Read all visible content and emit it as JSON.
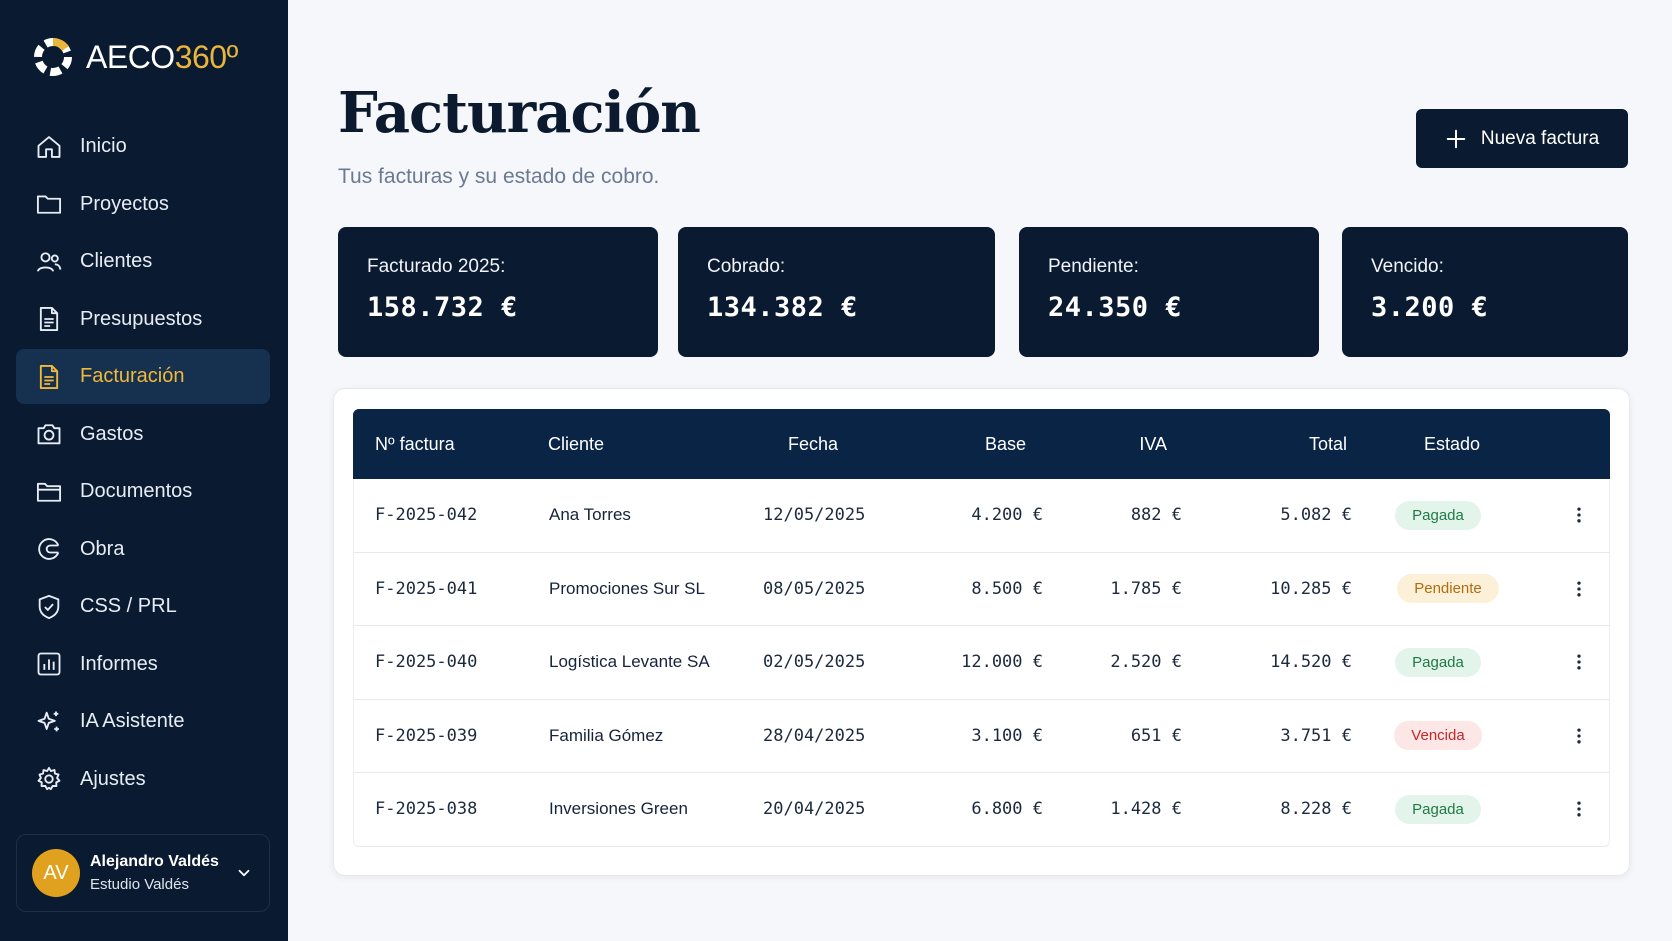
{
  "brand": {
    "name": "AECO",
    "suffix": "360º",
    "accent": "#e9b53a"
  },
  "sidebar": {
    "items": [
      {
        "label": "Inicio",
        "icon": "home-icon"
      },
      {
        "label": "Proyectos",
        "icon": "folder-icon"
      },
      {
        "label": "Clientes",
        "icon": "users-icon"
      },
      {
        "label": "Presupuestos",
        "icon": "document-icon"
      },
      {
        "label": "Facturación",
        "icon": "invoice-icon",
        "active": true
      },
      {
        "label": "Gastos",
        "icon": "camera-icon"
      },
      {
        "label": "Documentos",
        "icon": "folders-icon"
      },
      {
        "label": "Obra",
        "icon": "helmet-icon"
      },
      {
        "label": "CSS / PRL",
        "icon": "shield-icon"
      },
      {
        "label": "Informes",
        "icon": "chart-icon"
      },
      {
        "label": "IA Asistente",
        "icon": "sparkles-icon"
      },
      {
        "label": "Ajustes",
        "icon": "gear-icon"
      }
    ],
    "user": {
      "initials": "AV",
      "name": "Alejandro Valdés",
      "org": "Estudio Valdés"
    }
  },
  "header": {
    "title": "Facturación",
    "subtitle": "Tus facturas y su estado de cobro.",
    "new_button": "Nueva factura"
  },
  "stats": [
    {
      "label": "Facturado 2025:",
      "value": "158.732 €"
    },
    {
      "label": "Cobrado:",
      "value": "134.382 €"
    },
    {
      "label": "Pendiente:",
      "value": "24.350 €"
    },
    {
      "label": "Vencido:",
      "value": "3.200 €"
    }
  ],
  "table": {
    "columns": [
      "Nº factura",
      "Cliente",
      "Fecha",
      "Base",
      "IVA",
      "Total",
      "Estado"
    ],
    "rows": [
      {
        "number": "F-2025-042",
        "client": "Ana Torres",
        "date": "12/05/2025",
        "base": "4.200 €",
        "iva": "882 €",
        "total": "5.082 €",
        "status": "Pagada",
        "status_kind": "paid"
      },
      {
        "number": "F-2025-041",
        "client": "Promociones Sur SL",
        "date": "08/05/2025",
        "base": "8.500 €",
        "iva": "1.785 €",
        "total": "10.285 €",
        "status": "Pendiente",
        "status_kind": "pending"
      },
      {
        "number": "F-2025-040",
        "client": "Logística Levante SA",
        "date": "02/05/2025",
        "base": "12.000 €",
        "iva": "2.520 €",
        "total": "14.520 €",
        "status": "Pagada",
        "status_kind": "paid"
      },
      {
        "number": "F-2025-039",
        "client": "Familia Gómez",
        "date": "28/04/2025",
        "base": "3.100 €",
        "iva": "651 €",
        "total": "3.751 €",
        "status": "Vencida",
        "status_kind": "overdue"
      },
      {
        "number": "F-2025-038",
        "client": "Inversiones Green",
        "date": "20/04/2025",
        "base": "6.800 €",
        "iva": "1.428 €",
        "total": "8.228 €",
        "status": "Pagada",
        "status_kind": "paid"
      }
    ]
  },
  "colors": {
    "sidebar_bg": "#0a1a30",
    "active_item": "#f0b93a",
    "paid": "#1f7a45",
    "pending": "#b06d10",
    "overdue": "#c0282b"
  }
}
